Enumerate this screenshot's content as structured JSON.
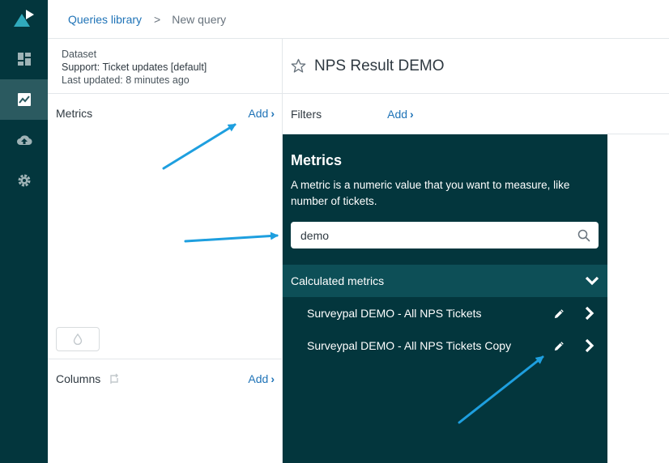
{
  "breadcrumb": {
    "link": "Queries library",
    "separator": ">",
    "current": "New query"
  },
  "dataset": {
    "heading": "Dataset",
    "name": "Support: Ticket updates [default]",
    "updated": "Last updated: 8 minutes ago"
  },
  "metrics_section": {
    "label": "Metrics",
    "add_label": "Add"
  },
  "columns_section": {
    "label": "Columns",
    "add_label": "Add"
  },
  "query": {
    "title": "NPS Result DEMO"
  },
  "filters": {
    "label": "Filters",
    "add_label": "Add"
  },
  "popup": {
    "title": "Metrics",
    "description": "A metric is a numeric value that you want to measure, like number of tickets.",
    "search_value": "demo",
    "group_label": "Calculated metrics",
    "items": [
      {
        "label": "Surveypal DEMO - All NPS Tickets"
      },
      {
        "label": "Surveypal DEMO - All NPS Tickets Copy"
      }
    ]
  },
  "colors": {
    "rail": "#03363d",
    "popup": "#03363d",
    "group": "#0d4f57",
    "link": "#1f73b7",
    "arrow": "#1e9fdf"
  },
  "icons": [
    "logo-icon",
    "dashboard-icon",
    "reports-icon",
    "upload-icon",
    "gear-icon",
    "star-icon",
    "search-icon",
    "chevron-down-icon",
    "pencil-icon",
    "chevron-right-icon",
    "drop-icon",
    "swap-icon"
  ]
}
